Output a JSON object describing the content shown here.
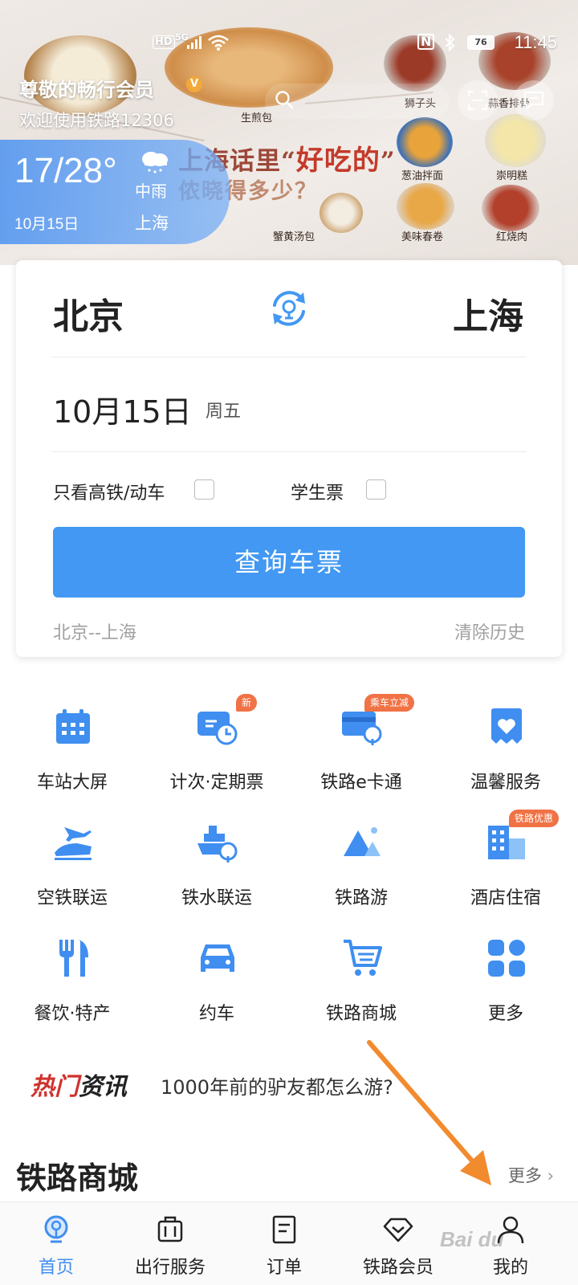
{
  "status_bar": {
    "hd": "HD",
    "network": "5G",
    "nfc": "N",
    "battery": "76",
    "time": "11:45"
  },
  "banner": {
    "greeting_title": "尊敬的畅行会员",
    "vip_mark": "V",
    "greeting_sub": "欢迎使用铁路12306",
    "poster_title_pre": "上海话里“",
    "poster_title_hl": "好吃的",
    "poster_title_post": "”",
    "poster_sub": "侬晓得多少？",
    "foods": [
      "生煎包",
      "狮子头",
      "蒜香排骨",
      "葱油拌面",
      "崇明糕",
      "蟹黄汤包",
      "美味春卷",
      "红烧肉"
    ]
  },
  "weather": {
    "temp": "17/28°",
    "date": "10月15日",
    "condition": "中雨",
    "city": "上海"
  },
  "query": {
    "from": "北京",
    "to": "上海",
    "date": "10月15日",
    "weekday": "周五",
    "high_speed_only": "只看高铁/动车",
    "student": "学生票",
    "button": "查询车票",
    "history": "北京--上海",
    "clear": "清除历史"
  },
  "services": [
    {
      "label": "车站大屏",
      "icon": "calendar-icon",
      "badge": ""
    },
    {
      "label": "计次·定期票",
      "icon": "ticket-clock-icon",
      "badge": "新"
    },
    {
      "label": "铁路e卡通",
      "icon": "rail-card-icon",
      "badge": "乘车立减"
    },
    {
      "label": "温馨服务",
      "icon": "heart-service-icon",
      "badge": ""
    },
    {
      "label": "空铁联运",
      "icon": "plane-train-icon",
      "badge": ""
    },
    {
      "label": "铁水联运",
      "icon": "ship-train-icon",
      "badge": ""
    },
    {
      "label": "铁路游",
      "icon": "mountain-travel-icon",
      "badge": ""
    },
    {
      "label": "酒店住宿",
      "icon": "hotel-icon",
      "badge": "铁路优惠"
    },
    {
      "label": "餐饮·特产",
      "icon": "fork-knife-icon",
      "badge": ""
    },
    {
      "label": "约车",
      "icon": "car-icon",
      "badge": ""
    },
    {
      "label": "铁路商城",
      "icon": "shopping-cart-icon",
      "badge": ""
    },
    {
      "label": "更多",
      "icon": "more-grid-icon",
      "badge": ""
    }
  ],
  "news": {
    "tag_a": "热门",
    "tag_b": "资讯",
    "headline": "1000年前的驴友都怎么游?"
  },
  "mall": {
    "title": "铁路商城",
    "more": "更多"
  },
  "nav": {
    "items": [
      {
        "label": "首页",
        "icon": "home-rail-icon",
        "active": true
      },
      {
        "label": "出行服务",
        "icon": "luggage-icon",
        "active": false
      },
      {
        "label": "订单",
        "icon": "order-list-icon",
        "active": false
      },
      {
        "label": "铁路会员",
        "icon": "diamond-icon",
        "active": false
      },
      {
        "label": "我的",
        "icon": "user-icon",
        "active": false
      }
    ]
  },
  "colors": {
    "primary": "#4298f2",
    "badge": "#f07245",
    "nav_active": "#3f8ef0",
    "arrow": "#f28a2e"
  }
}
